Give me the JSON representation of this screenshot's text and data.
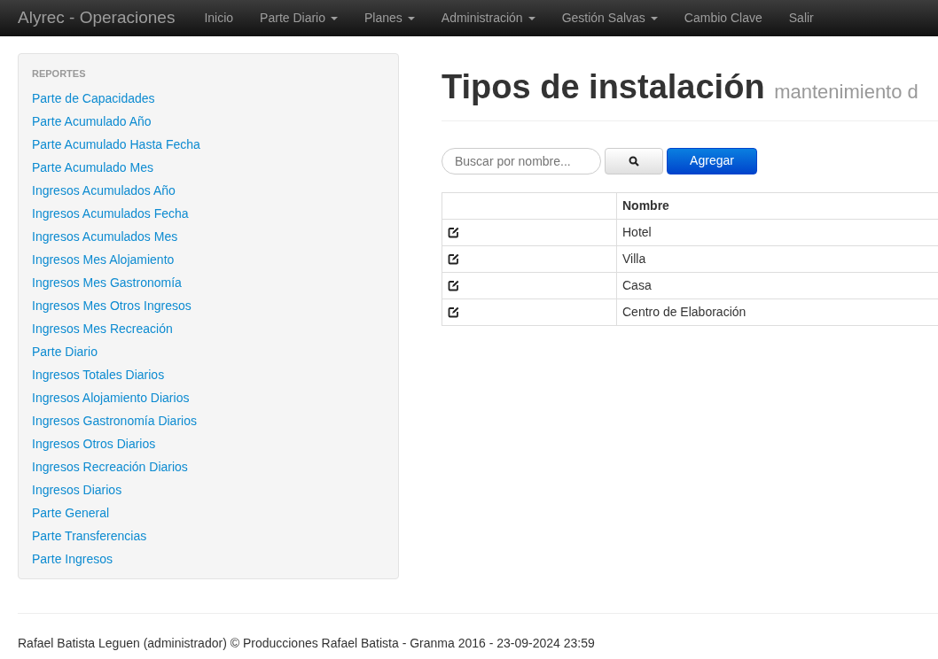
{
  "navbar": {
    "brand": "Alyrec - Operaciones",
    "items": [
      {
        "label": "Inicio",
        "dropdown": false
      },
      {
        "label": "Parte Diario",
        "dropdown": true
      },
      {
        "label": "Planes",
        "dropdown": true
      },
      {
        "label": "Administración",
        "dropdown": true
      },
      {
        "label": "Gestión Salvas",
        "dropdown": true
      },
      {
        "label": "Cambio Clave",
        "dropdown": false
      },
      {
        "label": "Salir",
        "dropdown": false
      }
    ]
  },
  "sidebar": {
    "heading": "REPORTES",
    "items": [
      "Parte de Capacidades",
      "Parte Acumulado Año",
      "Parte Acumulado Hasta Fecha",
      "Parte Acumulado Mes",
      "Ingresos Acumulados Año",
      "Ingresos Acumulados Fecha",
      "Ingresos Acumulados Mes",
      "Ingresos Mes Alojamiento",
      "Ingresos Mes Gastronomía",
      "Ingresos Mes Otros Ingresos",
      "Ingresos Mes Recreación",
      "Parte Diario",
      "Ingresos Totales Diarios",
      "Ingresos Alojamiento Diarios",
      "Ingresos Gastronomía Diarios",
      "Ingresos Otros Diarios",
      "Ingresos Recreación Diarios",
      "Ingresos Diarios",
      "Parte General",
      "Parte Transferencias",
      "Parte Ingresos"
    ]
  },
  "page": {
    "title": "Tipos de instalación",
    "subtitle": "mantenimiento d"
  },
  "search": {
    "placeholder": "Buscar por nombre..."
  },
  "add_button": "Agregar",
  "table": {
    "columns": [
      "Nombre"
    ],
    "rows": [
      "Hotel",
      "Villa",
      "Casa",
      "Centro de Elaboración"
    ]
  },
  "footer": "Rafael Batista Leguen (administrador) © Producciones Rafael Batista - Granma 2016 - 23-09-2024 23:59"
}
